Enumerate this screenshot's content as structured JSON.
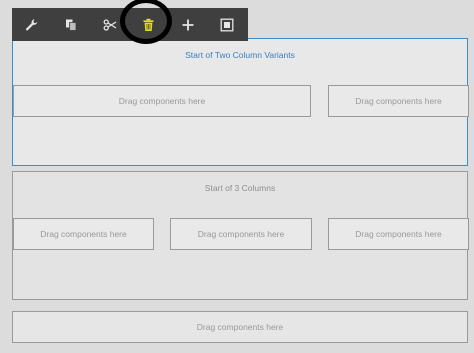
{
  "toolbar": {
    "tools": [
      {
        "name": "wrench-icon",
        "label": "Configure"
      },
      {
        "name": "copy-icon",
        "label": "Copy"
      },
      {
        "name": "scissors-icon",
        "label": "Cut"
      },
      {
        "name": "trash-icon",
        "label": "Delete",
        "highlighted": true,
        "color": "#e2e21a"
      },
      {
        "name": "plus-icon",
        "label": "Insert"
      },
      {
        "name": "frame-icon",
        "label": "Group"
      }
    ]
  },
  "colors": {
    "selection_border": "#3b8ec9",
    "highlight_icon": "#e2e21a",
    "toolbar_bg": "#3f3f3f"
  },
  "two_column": {
    "title": "Start of Two Column Variants",
    "placeholders": [
      "Drag components here",
      "Drag components here"
    ]
  },
  "three_column": {
    "title": "Start of 3 Columns",
    "placeholders": [
      "Drag components here",
      "Drag components here",
      "Drag components here"
    ]
  },
  "bottom": {
    "placeholder": "Drag components here"
  }
}
